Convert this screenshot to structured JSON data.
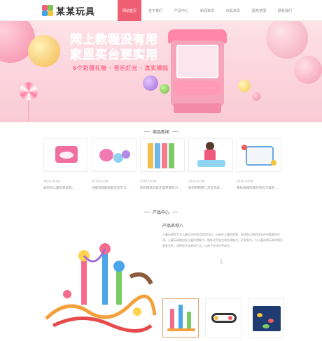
{
  "header": {
    "logo_text": "某某玩具",
    "nav": [
      "网站首页",
      "关于我们",
      "产品中心",
      "新闻资讯",
      "玩具资讯",
      "服务范围",
      "联系我们"
    ],
    "active_index": 0
  },
  "banner": {
    "title_line1": "网上教程没有用",
    "title_line2": "家里买台更实用",
    "subtitle": "6个彩蛋礼物 · 音乐灯光 · 真实模拟",
    "slide_count": 2,
    "active_slide": 0
  },
  "news": {
    "title": "商品新闻",
    "items": [
      {
        "date": "2019-10-08",
        "title": "如何为儿童玩具选购..."
      },
      {
        "date": "2019-10-08",
        "title": "创意玩具能帮助宝宝学习..."
      },
      {
        "date": "2019-10-08",
        "title": "如何挑选玩具才能开发智力..."
      },
      {
        "date": "2019-10-08",
        "title": "如何判断婴儿宝宝玩具..."
      },
      {
        "date": "2019-10-08",
        "title": "家长选择玩具时的五大误区..."
      }
    ]
  },
  "products": {
    "title": "产品中心",
    "name": "产品名称八",
    "description": "儿童玩具是专为儿童设计的各类游戏用品，玩具在儿童的智慧、身体和心理的成长中有重要的作用。儿童玩具能启发儿童的想象力，锻炼动手能力和协调能力，开发智力。为儿童选择玩具时要注意安全性，选择适合年龄的产品，让孩子在快乐中成长。",
    "arrow": "↓"
  }
}
